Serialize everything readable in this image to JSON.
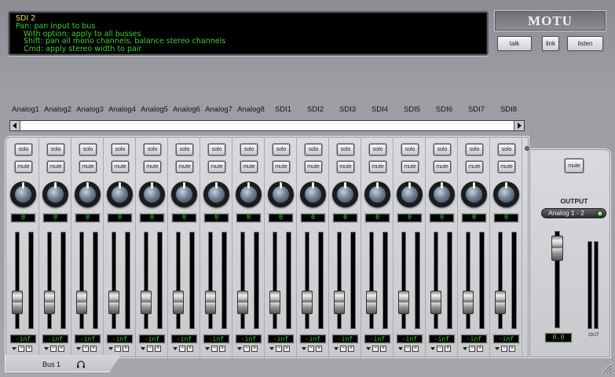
{
  "info": {
    "title": "SDI 2",
    "lines": [
      "Pan: pan input to bus",
      "With option: apply to all busses",
      "Shift: pan all mono channels, balance stereo channels",
      "Cmd: apply stereo width to pair"
    ]
  },
  "header": {
    "logo": "MOTU",
    "talk_label": "talk",
    "link_label": "link",
    "listen_label": "listen"
  },
  "channels": [
    {
      "name": "Analog1",
      "pan": "0",
      "level": "-inf",
      "fader": 0.2
    },
    {
      "name": "Analog2",
      "pan": "0",
      "level": "-inf",
      "fader": 0.2
    },
    {
      "name": "Analog3",
      "pan": "0",
      "level": "-inf",
      "fader": 0.2
    },
    {
      "name": "Analog4",
      "pan": "0",
      "level": "-inf",
      "fader": 0.2
    },
    {
      "name": "Analog5",
      "pan": "0",
      "level": "-inf",
      "fader": 0.2
    },
    {
      "name": "Analog6",
      "pan": "0",
      "level": "-inf",
      "fader": 0.2
    },
    {
      "name": "Analog7",
      "pan": "0",
      "level": "-inf",
      "fader": 0.2
    },
    {
      "name": "Analog8",
      "pan": "0",
      "level": "-inf",
      "fader": 0.2
    },
    {
      "name": "SDI1",
      "pan": "0",
      "level": "-inf",
      "fader": 0.2
    },
    {
      "name": "SDI2",
      "pan": "0",
      "level": "-inf",
      "fader": 0.2
    },
    {
      "name": "SDI3",
      "pan": "0",
      "level": "-inf",
      "fader": 0.2
    },
    {
      "name": "SDI4",
      "pan": "0",
      "level": "-inf",
      "fader": 0.2
    },
    {
      "name": "SDI5",
      "pan": "0",
      "level": "-inf",
      "fader": 0.2
    },
    {
      "name": "SDI6",
      "pan": "0",
      "level": "-inf",
      "fader": 0.2
    },
    {
      "name": "SDI7",
      "pan": "0",
      "level": "-inf",
      "fader": 0.2
    },
    {
      "name": "SDI8",
      "pan": "0",
      "level": "-inf",
      "fader": 0.2
    }
  ],
  "strip_labels": {
    "solo": "solo",
    "mute": "mute",
    "minus": "−",
    "plus": "+"
  },
  "output": {
    "mute_label": "mute",
    "title": "OUTPUT",
    "selected": "Analog 1 - 2",
    "level": "0.0",
    "fader": 0.95,
    "meter_label": "OUT"
  },
  "footer": {
    "bus_label": "Bus 1"
  },
  "icons": {
    "headphones": "headphones-icon",
    "grip": "resize-grip-icon"
  },
  "colors": {
    "display_text": "#3ed02c",
    "display_title": "#e6e23a",
    "led_green": "#2fa62a"
  }
}
